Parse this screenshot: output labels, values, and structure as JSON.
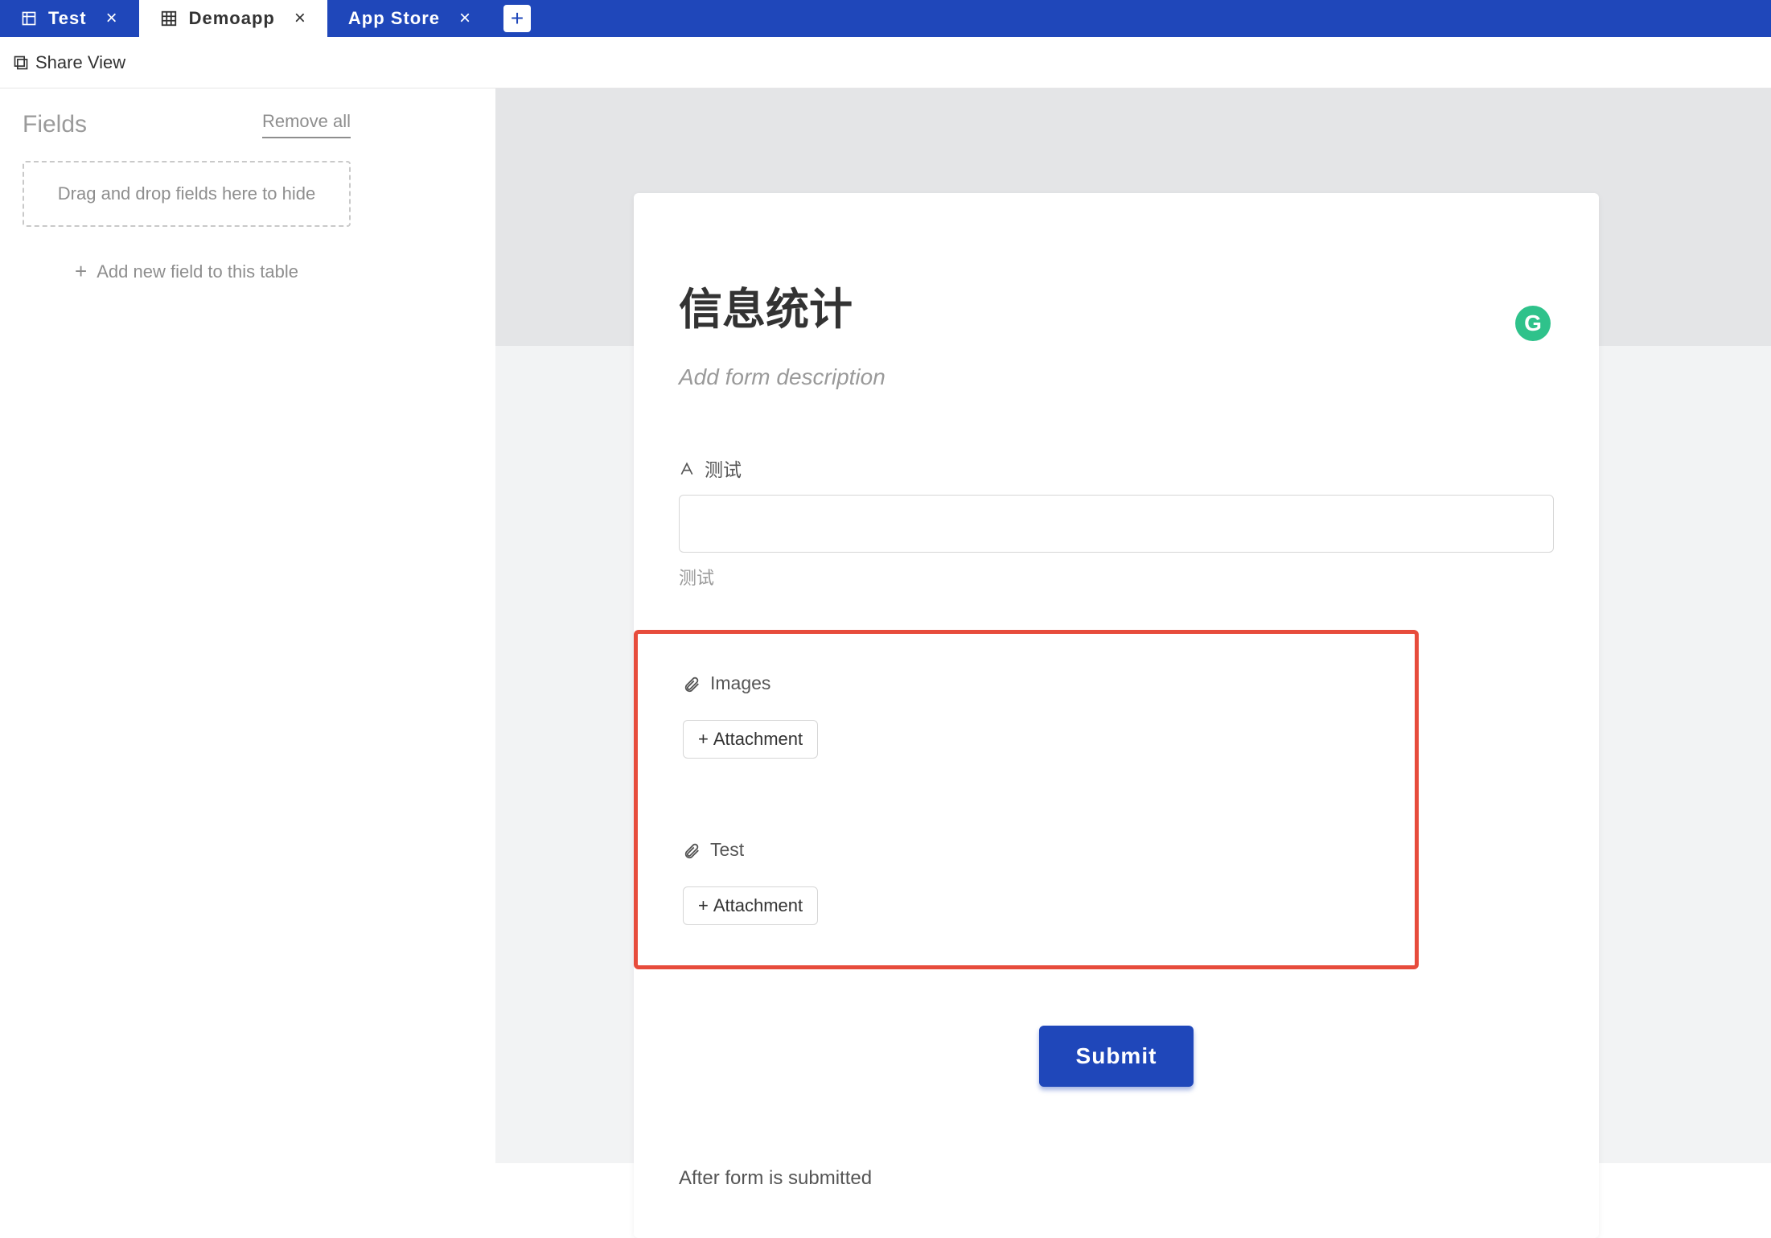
{
  "tabs": [
    {
      "label": "Test",
      "active": false
    },
    {
      "label": "Demoapp",
      "active": true
    },
    {
      "label": "App Store",
      "active": false
    }
  ],
  "toolbar": {
    "share_view": "Share View"
  },
  "sidebar": {
    "title": "Fields",
    "remove_all": "Remove all",
    "dropzone_text": "Drag and drop fields here to hide",
    "add_field": "Add new field to this table"
  },
  "form": {
    "title": "信息统计",
    "description_placeholder": "Add form description",
    "grammarly_label": "G",
    "fields": {
      "text": {
        "label": "测试",
        "help": "测试"
      },
      "images": {
        "label": "Images",
        "attach_label": "Attachment"
      },
      "test": {
        "label": "Test",
        "attach_label": "Attachment"
      }
    },
    "submit_label": "Submit",
    "after_submit": "After form is submitted"
  }
}
